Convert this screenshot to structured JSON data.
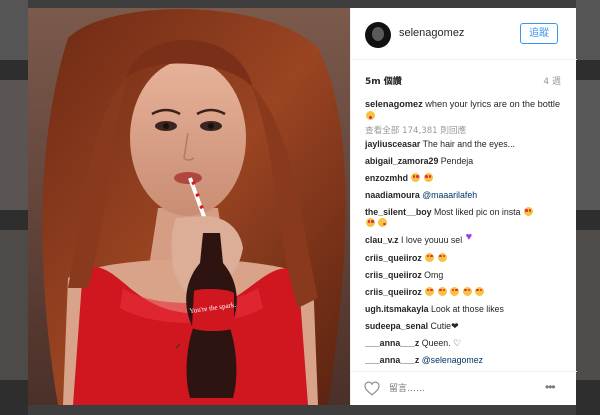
{
  "header": {
    "username": "selenagomez",
    "follow_label": "追蹤"
  },
  "meta": {
    "likes": "5m 個讚",
    "age": "4 週"
  },
  "caption": {
    "user": "selenagomez",
    "text": "when your lyrics are on the bottle"
  },
  "view_all": "查看全部 174,381 則回應",
  "photo": {
    "bottle_text": "You're the spark."
  },
  "comments": [
    {
      "user": "jayliusceasar",
      "text": "The hair and the eyes..."
    },
    {
      "user": "abigail_zamora29",
      "text": "Pendeja"
    },
    {
      "user": "enzozmhd",
      "text": ""
    },
    {
      "user": "naadiamoura",
      "text": "",
      "mention": "@maaarilafeh"
    },
    {
      "user": "the_silent__boy",
      "text": "Most liked pic on insta"
    },
    {
      "user": "clau_v.z",
      "text": "I love youuu sel"
    },
    {
      "user": "criis_queiiroz",
      "text": ""
    },
    {
      "user": "criis_queiiroz",
      "text": "Omg"
    },
    {
      "user": "criis_queiiroz",
      "text": ""
    },
    {
      "user": "ugh.itsmakayla",
      "text": "Look at those likes"
    },
    {
      "user": "sudeepa_senal",
      "text": "Cutie❤"
    },
    {
      "user": "___anna___z",
      "text": "Queen. ♡"
    },
    {
      "user": "___anna___z",
      "text": "",
      "mention": "@selenagomez"
    }
  ],
  "footer": {
    "comment_placeholder": "留言……",
    "more_label": "•••"
  },
  "icons": {
    "heart": "heart-icon",
    "more": "more-options-icon",
    "avatar": "avatar"
  },
  "colors": {
    "accent": "#3897f0",
    "mention": "#003569",
    "muted": "#999999"
  }
}
